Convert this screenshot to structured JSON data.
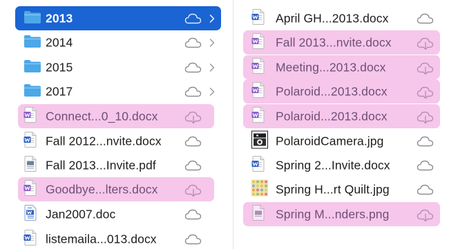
{
  "colors": {
    "selection": "#1a64d3",
    "pending_download": "#f6c7ea",
    "folder": "#4ca8e8",
    "word_blue": "#2f62c4",
    "word_purple": "#8a5ec8"
  },
  "left_column": {
    "items": [
      {
        "name": "2013",
        "kind": "folder",
        "state": "selected"
      },
      {
        "name": "2014",
        "kind": "folder",
        "state": "normal"
      },
      {
        "name": "2015",
        "kind": "folder",
        "state": "normal"
      },
      {
        "name": "2017",
        "kind": "folder",
        "state": "normal"
      },
      {
        "name": "Connect...0_10.docx",
        "kind": "word-doc",
        "state": "pending-download"
      },
      {
        "name": "Fall 2012...nvite.docx",
        "kind": "word-doc",
        "state": "normal"
      },
      {
        "name": "Fall 2013...Invite.pdf",
        "kind": "pdf",
        "state": "normal"
      },
      {
        "name": "Goodbye...lters.docx",
        "kind": "word-doc",
        "state": "pending-download"
      },
      {
        "name": "Jan2007.doc",
        "kind": "word-doc-legacy",
        "state": "normal"
      },
      {
        "name": "listemaila...013.docx",
        "kind": "word-doc",
        "state": "normal"
      }
    ]
  },
  "right_column": {
    "items": [
      {
        "name": "April GH...2013.docx",
        "kind": "word-doc",
        "state": "normal"
      },
      {
        "name": "Fall 2013...nvite.docx",
        "kind": "word-doc",
        "state": "pending-download"
      },
      {
        "name": "Meeting...2013.docx",
        "kind": "word-doc",
        "state": "pending-download"
      },
      {
        "name": "Polaroid...2013.docx",
        "kind": "word-doc",
        "state": "pending-download"
      },
      {
        "name": "Polaroid...2013.docx",
        "kind": "word-doc",
        "state": "pending-download"
      },
      {
        "name": "PolaroidCamera.jpg",
        "kind": "image-camera",
        "state": "normal"
      },
      {
        "name": "Spring 2...Invite.docx",
        "kind": "word-doc",
        "state": "normal"
      },
      {
        "name": "Spring H...rt Quilt.jpg",
        "kind": "image-quilt",
        "state": "normal"
      },
      {
        "name": "Spring M...nders.png",
        "kind": "png",
        "state": "pending-download"
      }
    ]
  }
}
